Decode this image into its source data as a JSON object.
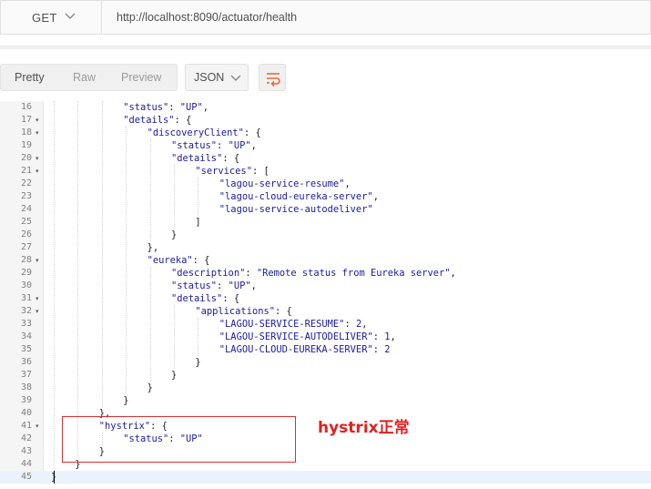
{
  "request": {
    "method": "GET",
    "url": "http://localhost:8090/actuator/health"
  },
  "response_toolbar": {
    "tabs": [
      "Pretty",
      "Raw",
      "Preview"
    ],
    "active_tab": "Pretty",
    "format": "JSON"
  },
  "editor": {
    "active_line": "45",
    "lines": [
      {
        "n": "16",
        "fold": false,
        "indent": 3,
        "tokens": [
          [
            "key",
            "\"status\""
          ],
          [
            "punct",
            ": "
          ],
          [
            "str",
            "\"UP\""
          ],
          [
            "punct",
            ","
          ]
        ]
      },
      {
        "n": "17",
        "fold": true,
        "indent": 3,
        "tokens": [
          [
            "key",
            "\"details\""
          ],
          [
            "punct",
            ": {"
          ]
        ]
      },
      {
        "n": "18",
        "fold": true,
        "indent": 4,
        "tokens": [
          [
            "key",
            "\"discoveryClient\""
          ],
          [
            "punct",
            ": {"
          ]
        ]
      },
      {
        "n": "19",
        "fold": false,
        "indent": 5,
        "tokens": [
          [
            "key",
            "\"status\""
          ],
          [
            "punct",
            ": "
          ],
          [
            "str",
            "\"UP\""
          ],
          [
            "punct",
            ","
          ]
        ]
      },
      {
        "n": "20",
        "fold": true,
        "indent": 5,
        "tokens": [
          [
            "key",
            "\"details\""
          ],
          [
            "punct",
            ": {"
          ]
        ]
      },
      {
        "n": "21",
        "fold": true,
        "indent": 6,
        "tokens": [
          [
            "key",
            "\"services\""
          ],
          [
            "punct",
            ": ["
          ]
        ]
      },
      {
        "n": "22",
        "fold": false,
        "indent": 7,
        "tokens": [
          [
            "str",
            "\"lagou-service-resume\""
          ],
          [
            "punct",
            ","
          ]
        ]
      },
      {
        "n": "23",
        "fold": false,
        "indent": 7,
        "tokens": [
          [
            "str",
            "\"lagou-cloud-eureka-server\""
          ],
          [
            "punct",
            ","
          ]
        ]
      },
      {
        "n": "24",
        "fold": false,
        "indent": 7,
        "tokens": [
          [
            "str",
            "\"lagou-service-autodeliver\""
          ]
        ]
      },
      {
        "n": "25",
        "fold": false,
        "indent": 6,
        "tokens": [
          [
            "punct",
            "]"
          ]
        ]
      },
      {
        "n": "26",
        "fold": false,
        "indent": 5,
        "tokens": [
          [
            "punct",
            "}"
          ]
        ]
      },
      {
        "n": "27",
        "fold": false,
        "indent": 4,
        "tokens": [
          [
            "punct",
            "},"
          ]
        ]
      },
      {
        "n": "28",
        "fold": true,
        "indent": 4,
        "tokens": [
          [
            "key",
            "\"eureka\""
          ],
          [
            "punct",
            ": {"
          ]
        ]
      },
      {
        "n": "29",
        "fold": false,
        "indent": 5,
        "tokens": [
          [
            "key",
            "\"description\""
          ],
          [
            "punct",
            ": "
          ],
          [
            "str",
            "\"Remote status from Eureka server\""
          ],
          [
            "punct",
            ","
          ]
        ]
      },
      {
        "n": "30",
        "fold": false,
        "indent": 5,
        "tokens": [
          [
            "key",
            "\"status\""
          ],
          [
            "punct",
            ": "
          ],
          [
            "str",
            "\"UP\""
          ],
          [
            "punct",
            ","
          ]
        ]
      },
      {
        "n": "31",
        "fold": true,
        "indent": 5,
        "tokens": [
          [
            "key",
            "\"details\""
          ],
          [
            "punct",
            ": {"
          ]
        ]
      },
      {
        "n": "32",
        "fold": true,
        "indent": 6,
        "tokens": [
          [
            "key",
            "\"applications\""
          ],
          [
            "punct",
            ": {"
          ]
        ]
      },
      {
        "n": "33",
        "fold": false,
        "indent": 7,
        "tokens": [
          [
            "key",
            "\"LAGOU-SERVICE-RESUME\""
          ],
          [
            "punct",
            ": "
          ],
          [
            "num",
            "2"
          ],
          [
            "punct",
            ","
          ]
        ]
      },
      {
        "n": "34",
        "fold": false,
        "indent": 7,
        "tokens": [
          [
            "key",
            "\"LAGOU-SERVICE-AUTODELIVER\""
          ],
          [
            "punct",
            ": "
          ],
          [
            "num",
            "1"
          ],
          [
            "punct",
            ","
          ]
        ]
      },
      {
        "n": "35",
        "fold": false,
        "indent": 7,
        "tokens": [
          [
            "key",
            "\"LAGOU-CLOUD-EUREKA-SERVER\""
          ],
          [
            "punct",
            ": "
          ],
          [
            "num",
            "2"
          ]
        ]
      },
      {
        "n": "36",
        "fold": false,
        "indent": 6,
        "tokens": [
          [
            "punct",
            "}"
          ]
        ]
      },
      {
        "n": "37",
        "fold": false,
        "indent": 5,
        "tokens": [
          [
            "punct",
            "}"
          ]
        ]
      },
      {
        "n": "38",
        "fold": false,
        "indent": 4,
        "tokens": [
          [
            "punct",
            "}"
          ]
        ]
      },
      {
        "n": "39",
        "fold": false,
        "indent": 3,
        "tokens": [
          [
            "punct",
            "}"
          ]
        ]
      },
      {
        "n": "40",
        "fold": false,
        "indent": 2,
        "tokens": [
          [
            "punct",
            "},"
          ]
        ]
      },
      {
        "n": "41",
        "fold": true,
        "indent": 2,
        "tokens": [
          [
            "key",
            "\"hystrix\""
          ],
          [
            "punct",
            ": {"
          ]
        ]
      },
      {
        "n": "42",
        "fold": false,
        "indent": 3,
        "tokens": [
          [
            "key",
            "\"status\""
          ],
          [
            "punct",
            ": "
          ],
          [
            "str",
            "\"UP\""
          ]
        ]
      },
      {
        "n": "43",
        "fold": false,
        "indent": 2,
        "tokens": [
          [
            "punct",
            "}"
          ]
        ]
      },
      {
        "n": "44",
        "fold": false,
        "indent": 1,
        "tokens": [
          [
            "punct",
            "}"
          ]
        ]
      },
      {
        "n": "45",
        "fold": false,
        "indent": 0,
        "tokens": [
          [
            "punct",
            "}"
          ]
        ]
      }
    ]
  },
  "annotation": {
    "label": "hystrix正常",
    "color": "#e02020"
  },
  "colors": {
    "json_token": "#1a1aa6",
    "gutter_bg": "#f5f5f5",
    "active_line_bg": "#eaf3fb"
  }
}
